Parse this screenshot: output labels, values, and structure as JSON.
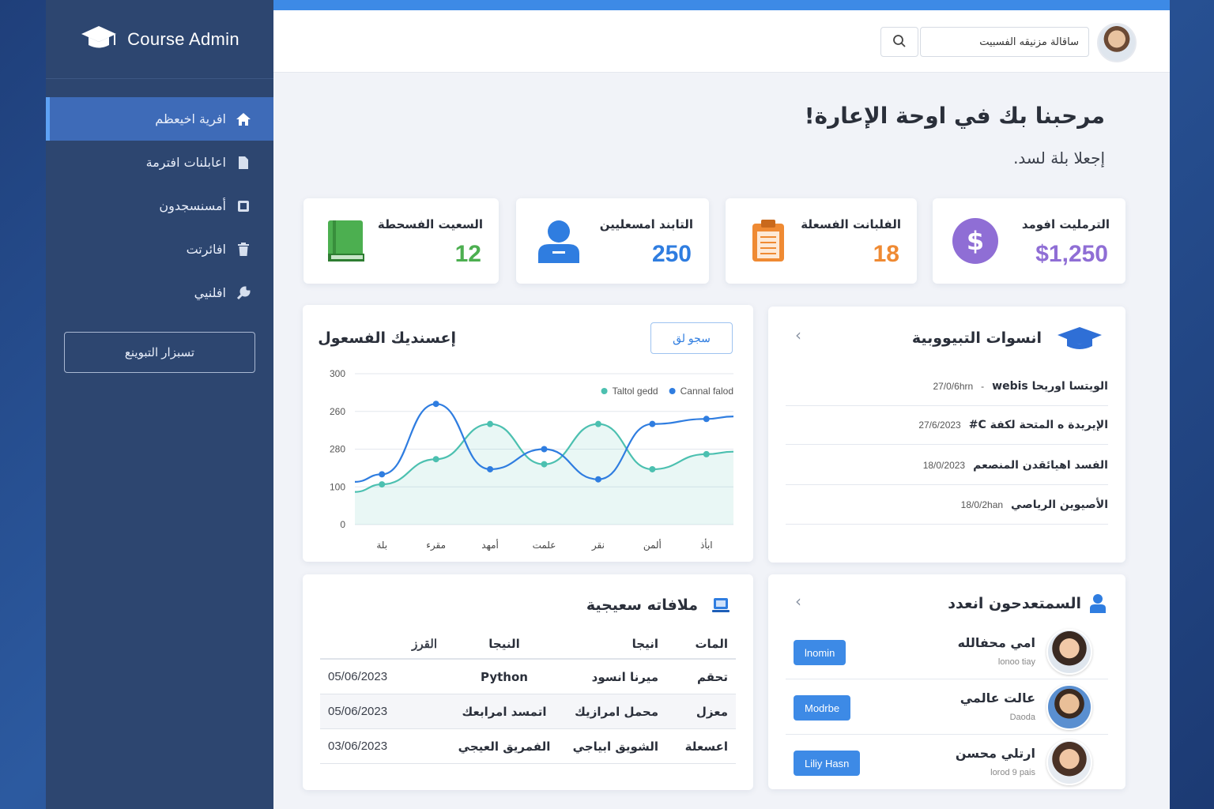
{
  "sidebar": {
    "brand": "Course Admin",
    "items": [
      {
        "label": "افرية اخيعظم",
        "icon": "home-icon",
        "active": true
      },
      {
        "label": "اعابلنات افترمة",
        "icon": "document-icon",
        "active": false
      },
      {
        "label": "أمسنسجدون",
        "icon": "users-icon",
        "active": false
      },
      {
        "label": "افائرتت",
        "icon": "trash-icon",
        "active": false
      },
      {
        "label": "افلنيي",
        "icon": "wrench-icon",
        "active": false
      }
    ],
    "button_label": "تسبزار التبوينع"
  },
  "header": {
    "search_value": "ساقالة مزنيقه الفسبيت",
    "search_icon": "search-icon"
  },
  "welcome": {
    "title": "مرحبنا بك في اوحة الإعارة!",
    "subtitle": "إجعلا بلة لسد."
  },
  "stats": [
    {
      "label": "الترمليت افومد",
      "value": "$1,250",
      "color": "#8f6ed5",
      "icon": "dollar-icon"
    },
    {
      "label": "الفلبانت الفسعلة",
      "value": "18",
      "color": "#ef8a33",
      "icon": "clipboard-icon"
    },
    {
      "label": "التابند امسعليين",
      "value": "250",
      "color": "#2f7de0",
      "icon": "user-icon"
    },
    {
      "label": "السعيت الفسحطة",
      "value": "12",
      "color": "#4caf50",
      "icon": "book-icon"
    }
  ],
  "chart_panel": {
    "title": "إعسنديك الفسعول",
    "filter_label": "سجو لق",
    "chart_data": {
      "type": "line",
      "categories": [
        "بلة",
        "مقرء",
        "أمهد",
        "علمت",
        "نقر",
        "ألمن",
        "ابأذ"
      ],
      "series": [
        {
          "name": "Taltol gedd",
          "color": "#4cc0b0",
          "values": [
            80,
            130,
            200,
            120,
            200,
            110,
            140
          ]
        },
        {
          "name": "Cannal falod",
          "color": "#2f7de0",
          "values": [
            100,
            240,
            110,
            150,
            90,
            200,
            210
          ]
        }
      ],
      "yticks": [
        "0",
        "100",
        "280",
        "260",
        "300"
      ],
      "ylim": [
        0,
        300
      ],
      "legend": "top-right",
      "grid": true
    }
  },
  "news_panel": {
    "title": "انسوات التبيووبية",
    "items": [
      {
        "text": "الويتسا اوريحا webis",
        "date": "27/0/6hrn"
      },
      {
        "text": "الإيريدة ه المتحة لكفة C#",
        "date": "27/6/2023"
      },
      {
        "text": "الفسد اهيائقدن المنصعم",
        "date": "18/0/2023"
      },
      {
        "text": "الأصيوين الرياصي",
        "date": "18/0/2han"
      }
    ]
  },
  "table_panel": {
    "title": "ملافاته سعيجية",
    "headers": [
      "المات",
      "انيجا",
      "النيجا",
      "القرز"
    ],
    "rows": [
      {
        "status": "تحقم",
        "name": "ميرنا انسود",
        "course": "Python",
        "date": "05/06/2023"
      },
      {
        "status": "معزل",
        "name": "محمل امرازيك",
        "course": "اتمسد امرابعك",
        "date": "05/06/2023"
      },
      {
        "status": "اعسعلة",
        "name": "الشويق ابياجي",
        "course": "الفمريق العيجي",
        "date": "03/06/2023"
      }
    ]
  },
  "users_panel": {
    "title": "السمتعدحون انعدد",
    "users": [
      {
        "name": "امي محفالله",
        "sub": "lonoo tiay",
        "button": "lnomin"
      },
      {
        "name": "عالت عالمي",
        "sub": "Daoda",
        "button": "Modrbe"
      },
      {
        "name": "ارتلي محسن",
        "sub": "lorod 9 pais",
        "button": "Liliy Hasn"
      }
    ]
  }
}
